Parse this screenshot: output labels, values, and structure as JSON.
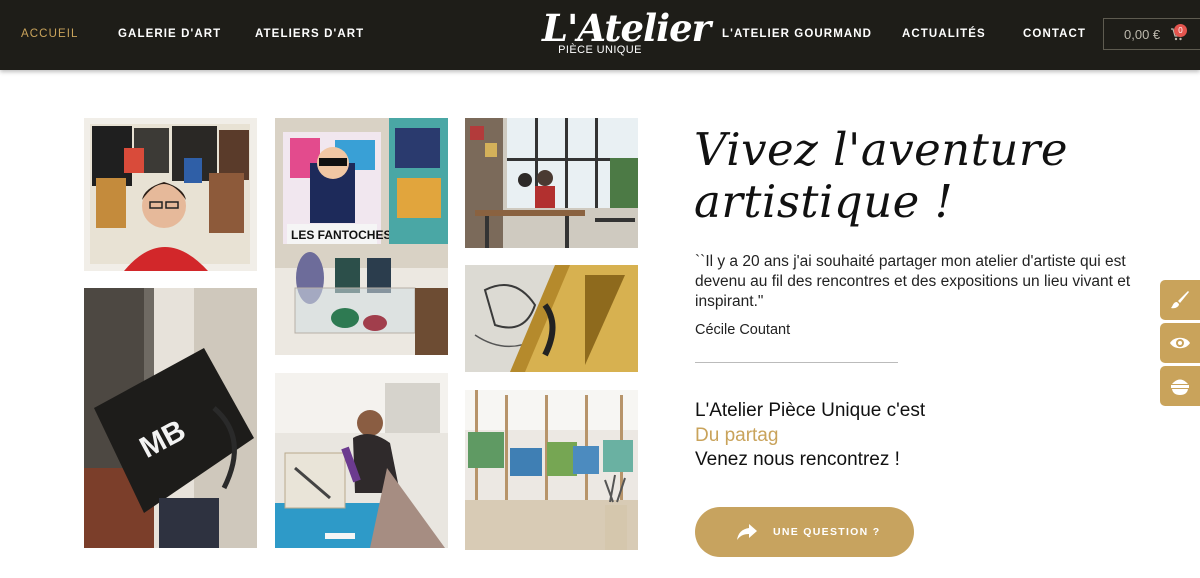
{
  "nav": {
    "left": [
      "ACCUEIL",
      "GALERIE D'ART",
      "ATELIERS D'ART"
    ],
    "right": [
      "L'ATELIER GOURMAND",
      "ACTUALITÉS",
      "CONTACT"
    ]
  },
  "logo": {
    "main": "L'Atelier",
    "sub": "PIÈCE UNIQUE"
  },
  "cart": {
    "amount": "0,00 €",
    "count": "0",
    "icon": "cart-icon"
  },
  "content": {
    "headline_line1": "Vivez l'aventure",
    "headline_line2": "artistique !",
    "quote": "``Il y a 20 ans j'ai souhaité partager mon atelier d'artiste qui est devenu au fil des rencontres et des expositions un lieu vivant et inspirant.\"",
    "author": "Cécile Coutant",
    "tagline_1": "L'Atelier Pièce Unique c'est",
    "tagline_2": "Du partag",
    "tagline_3": "Venez nous rencontrez !"
  },
  "cta": {
    "label": "UNE QUESTION ?",
    "icon": "share-arrow-icon"
  },
  "side_buttons": [
    "paintbrush-icon",
    "eye-icon",
    "bowl-icon"
  ],
  "colors": {
    "gold": "#c9a35b",
    "header_bg": "#1e1d18",
    "badge": "#e4554e"
  }
}
